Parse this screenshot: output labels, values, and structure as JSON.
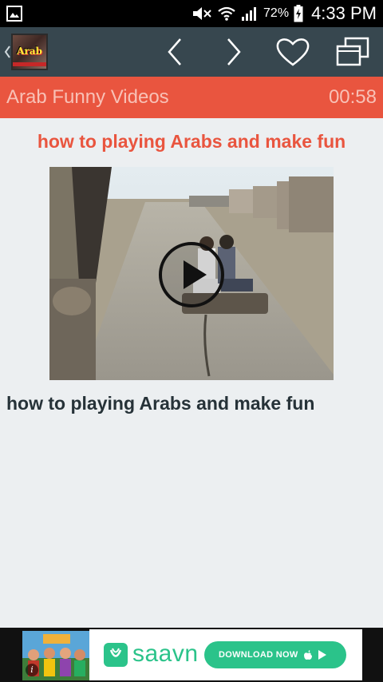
{
  "status_bar": {
    "battery_percent": "72%",
    "time": "4:33 PM",
    "icons": [
      "image-notification-icon",
      "mute-icon",
      "wifi-icon",
      "signal-icon",
      "battery-charging-icon"
    ]
  },
  "toolbar": {
    "logo_text": "Arab",
    "icons": [
      "back-caret-icon",
      "previous-icon",
      "next-icon",
      "heart-icon",
      "windows-icon"
    ]
  },
  "title_bar": {
    "title": "Arab Funny Videos",
    "timer": "00:58"
  },
  "video": {
    "heading": "how to playing Arabs and make fun",
    "caption": "how to playing Arabs and make fun",
    "icon": "play-icon"
  },
  "ad": {
    "brand": "saavn",
    "button_label": "DOWNLOAD NOW",
    "icons": [
      "info-icon",
      "saavn-logo-icon",
      "apple-icon",
      "play-store-icon"
    ]
  },
  "colors": {
    "status_bar": "#000000",
    "toolbar": "#37474f",
    "title_bar": "#e9553f",
    "title_text": "#f8c1b6",
    "heading_red": "#e9553f",
    "caption_dark": "#263238",
    "background": "#eceff1",
    "saavn_green": "#2bc38a"
  }
}
